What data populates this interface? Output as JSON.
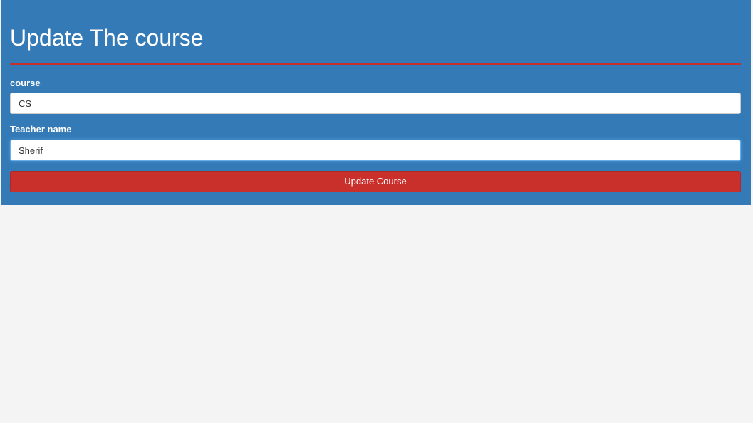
{
  "page": {
    "title": "Update The course"
  },
  "form": {
    "course_label": "course",
    "course_value": "CS",
    "teacher_label": "Teacher name",
    "teacher_value": "Sherif",
    "submit_label": "Update Course"
  },
  "colors": {
    "panel": "#337ab7",
    "accent": "#c9302c",
    "page_background": "#f4f4f4"
  }
}
